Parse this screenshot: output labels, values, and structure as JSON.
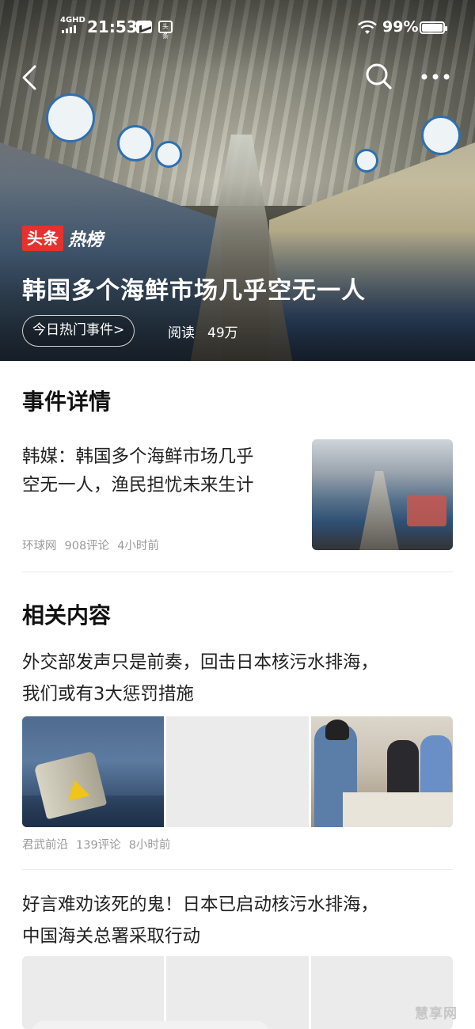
{
  "status_bar": {
    "network": "4GHD",
    "time": "21:53",
    "app_badge": "头条",
    "battery": "99%"
  },
  "hero": {
    "brand_red": "头条",
    "brand_white": "热榜",
    "title": "韩国多个海鲜市场几乎空无一人",
    "event_pill": "今日热门事件>",
    "read_label": "阅读",
    "read_count": "49万"
  },
  "event_section": {
    "title": "事件详情",
    "article": {
      "title_line1": "韩媒：韩国多个海鲜市场几乎",
      "title_line2": "空无一人，渔民担忧未来生计",
      "source": "环球网",
      "comments": "908评论",
      "time": "4小时前"
    }
  },
  "related_section": {
    "title": "相关内容",
    "articles": [
      {
        "title_line1": "外交部发声只是前奏，回击日本核污水排海，",
        "title_line2": "我们或有3大惩罚措施",
        "source": "君武前沿",
        "comments": "139评论",
        "time": "8小时前"
      },
      {
        "title_line1": "好言难劝该死的鬼！日本已启动核污水排海，",
        "title_line2": "中国海关总署采取行动"
      }
    ]
  },
  "watermark": "慧享网",
  "colors": {
    "brand_red": "#e5322d",
    "meta_gray": "#9a9a9a",
    "placeholder_gray": "#ebebeb"
  },
  "icons": [
    "back-icon",
    "search-icon",
    "more-icon",
    "wifi-icon",
    "battery-icon",
    "signal-icon",
    "message-icon",
    "toutiao-icon"
  ]
}
